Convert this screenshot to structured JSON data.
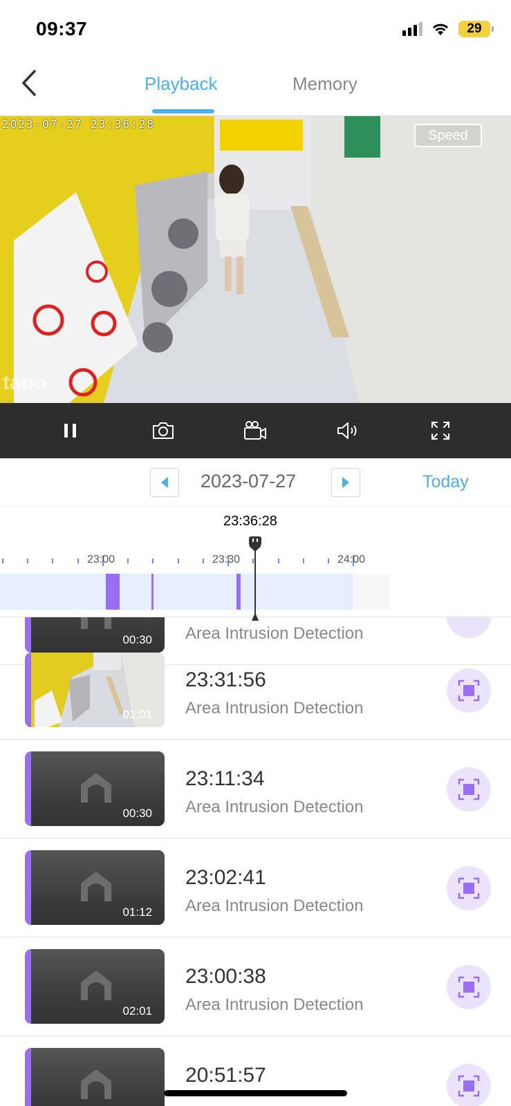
{
  "status_bar": {
    "time": "09:37",
    "battery": "29"
  },
  "nav": {
    "tabs": [
      {
        "label": "Playback",
        "active": true
      },
      {
        "label": "Memory",
        "active": false
      }
    ],
    "accent_color": "#4ab0e8"
  },
  "video": {
    "timestamp": "2023-07-27  23:36:28",
    "speed_label": "Speed",
    "watermark": "tapo"
  },
  "controls": [
    "pause-icon",
    "camera-icon",
    "record-video-icon",
    "speaker-icon",
    "fullscreen-icon"
  ],
  "date_bar": {
    "date": "2023-07-27",
    "today_label": "Today"
  },
  "timeline": {
    "current_time": "23:36:28",
    "tick_labels": [
      "23:00",
      "23:30",
      "24:00"
    ],
    "event_color": "#9a6ef0"
  },
  "events": [
    {
      "time": "",
      "type": "Area Intrusion Detection",
      "duration": "00:30",
      "has_preview": false
    },
    {
      "time": "23:31:56",
      "type": "Area Intrusion Detection",
      "duration": "01:01",
      "has_preview": true
    },
    {
      "time": "23:11:34",
      "type": "Area Intrusion Detection",
      "duration": "00:30",
      "has_preview": false
    },
    {
      "time": "23:02:41",
      "type": "Area Intrusion Detection",
      "duration": "01:12",
      "has_preview": false
    },
    {
      "time": "23:00:38",
      "type": "Area Intrusion Detection",
      "duration": "02:01",
      "has_preview": false
    },
    {
      "time": "20:51:57",
      "type": "",
      "duration": "",
      "has_preview": false
    }
  ]
}
